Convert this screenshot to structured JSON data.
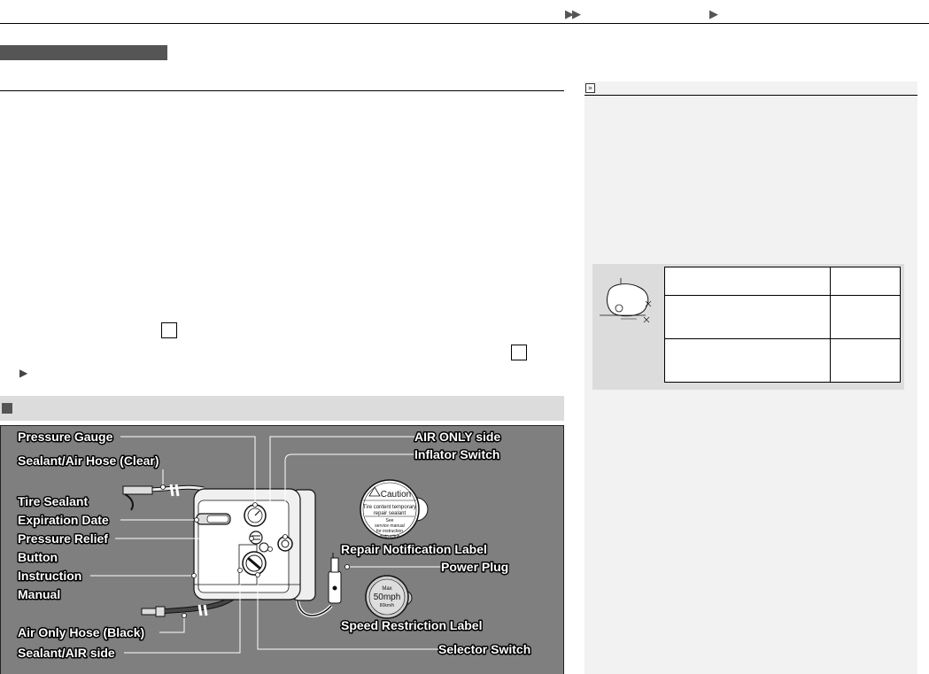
{
  "breadcrumb": {
    "arrows_1": "▶▶",
    "arrows_2": "▶"
  },
  "main": {
    "arrow": "▶"
  },
  "figure": {
    "labels": {
      "pressure_gauge": "Pressure Gauge",
      "sealant_air_hose": "Sealant/Air Hose (Clear)",
      "tire_sealant_1": "Tire Sealant",
      "tire_sealant_2": "Expiration Date",
      "pressure_relief_1": "Pressure Relief",
      "pressure_relief_2": "Button",
      "instruction_1": "Instruction",
      "instruction_2": "Manual",
      "air_only_hose": "Air Only Hose (Black)",
      "sealant_air_side": "Sealant/AIR side",
      "air_only_side": "AIR ONLY side",
      "inflator_switch": "Inflator Switch",
      "repair_label": "Repair Notification Label",
      "power_plug": "Power Plug",
      "speed_label": "Speed Restriction Label",
      "selector_switch": "Selector Switch"
    },
    "caution": {
      "title": "Caution",
      "line1": "Tire content temporary",
      "line2": "repair sealant",
      "line3": "See",
      "line4": "service manual",
      "line5": "for instruction",
      "line6": "instruction"
    },
    "speed": {
      "line1": "Max",
      "line2": "50mph",
      "line3": "80km/h"
    }
  },
  "sidebar": {
    "icon": "»"
  },
  "colors": {
    "label_fill": "#ffffff",
    "label_stroke": "#000000",
    "sidebar_bg": "#f2f2f2",
    "bar_dark": "#555555",
    "bar_light": "#dcdcdc"
  }
}
